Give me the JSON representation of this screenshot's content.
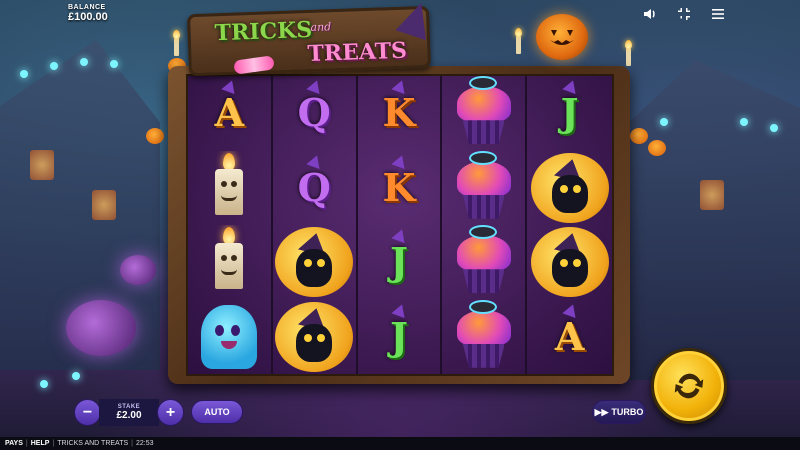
{
  "balance": {
    "label": "BALANCE",
    "value": "£100.00"
  },
  "top_icons": [
    "speaker-icon",
    "collapse-icon",
    "menu-icon"
  ],
  "logo": {
    "line1": "TRICKS",
    "and": "and",
    "line2": "TREATS"
  },
  "reels": [
    [
      "A",
      "candle-character",
      "candle-character",
      "ghost"
    ],
    [
      "Q",
      "Q",
      "black-cat",
      "black-cat"
    ],
    [
      "K",
      "K",
      "J",
      "J"
    ],
    [
      "cupcake",
      "cupcake",
      "cupcake",
      "cupcake"
    ],
    [
      "J",
      "black-cat",
      "black-cat",
      "A"
    ]
  ],
  "stake": {
    "label": "STAKE",
    "value": "£2.00",
    "minus": "−",
    "plus": "+"
  },
  "auto_label": "AUTO",
  "turbo_label": "TURBO",
  "footer": {
    "pays": "PAYS",
    "help": "HELP",
    "game": "TRICKS AND TREATS",
    "time": "22:53"
  },
  "colors": {
    "spin": "#f2b20a",
    "button": "#5e3fc0",
    "reel_bg": "#3a184e",
    "frame": "#5b3a1f"
  }
}
